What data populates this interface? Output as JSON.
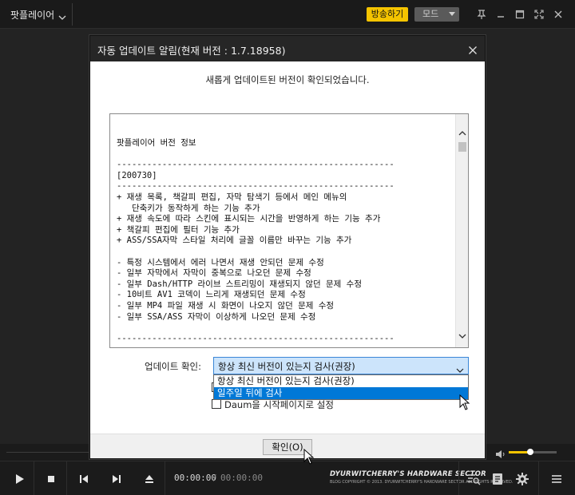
{
  "app": {
    "title": "팟플레이어",
    "broadcast_label": "방송하기",
    "mode_label": "모드"
  },
  "player": {
    "time_current": "00:00:00",
    "time_separator": "/",
    "time_total": "00:00:00",
    "volume_level": 0.45,
    "brand_name": "DYURWITCHERRY'S HARDWARE SECTOR",
    "brand_copyright": "BLOG COPYRIGHT © 2013. DYURWITCHERRY'S HARDWARE SECTOR ALL RIGHTS RESERVED."
  },
  "dialog": {
    "title": "자동 업데이트 알림(현재 버전 : 1.7.18958)",
    "message": "새롭게 업데이트된 버전이 확인되었습니다.",
    "notes_lines": [
      "팟플레이어 버전 정보",
      "",
      "-------------------------------------------------------",
      "[200730]",
      "-------------------------------------------------------",
      "+ 재생 목록, 책갈피 편집, 자막 탐색기 등에서 메인 메뉴의",
      "   단축키가 동작하게 하는 기능 추가",
      "+ 재생 속도에 따라 스킨에 표시되는 시간을 반영하게 하는 기능 추가",
      "+ 책갈피 편집에 필터 기능 추가",
      "+ ASS/SSA자막 스타일 처리에 글꼴 이름만 바꾸는 기능 추가",
      "",
      "- 특정 시스템에서 에러 나면서 재생 안되던 문제 수정",
      "- 일부 자막에서 자막이 중복으로 나오던 문제 수정",
      "- 일부 Dash/HTTP 라이브 스트리밍이 재생되지 않던 문제 수정",
      "- 10비트 AV1 코덱이 느리게 재생되던 문제 수정",
      "- 일부 MP4 파일 재생 시 화면이 나오지 않던 문제 수정",
      "- 일부 SSA/ASS 자막이 이상하게 나오던 문제 수정",
      "",
      "-------------------------------------------------------"
    ],
    "update_check_label": "업데이트 확인:",
    "update_check_value": "항상 최신 버전이 있는지 검사(권장)",
    "dropdown_options": [
      "항상 최신 버전이 있는지 검사(권장)",
      "일주일 뒤에 검사"
    ],
    "daum_label": "Daum을 시작페이지로 설정",
    "ok_label": "확인(O)"
  },
  "colors": {
    "accent": "#f5c400",
    "selection": "#0078d7",
    "dialog_title_bg": "#262626"
  }
}
